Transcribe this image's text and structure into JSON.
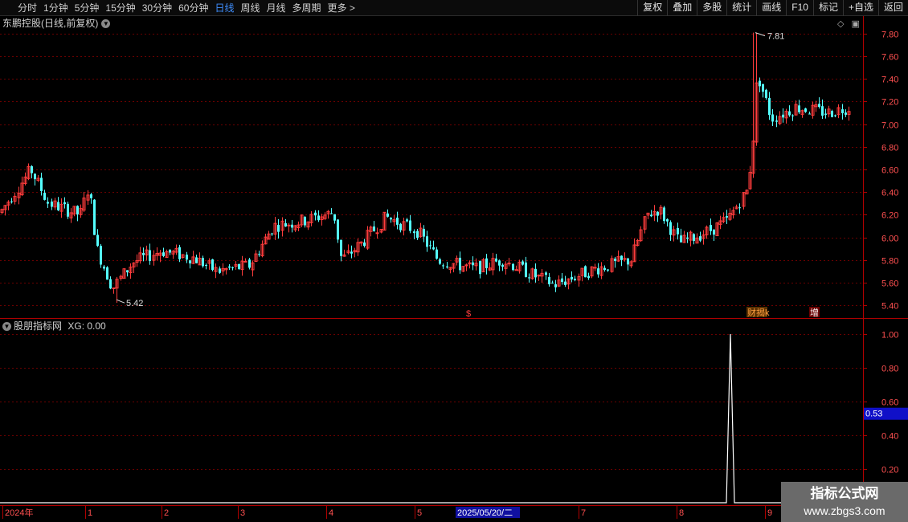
{
  "toolbar": {
    "periods": [
      "分时",
      "1分钟",
      "5分钟",
      "15分钟",
      "30分钟",
      "60分钟",
      "日线",
      "周线",
      "月线",
      "多周期",
      "更多 >"
    ],
    "active_period": "日线",
    "right_buttons": [
      "复权",
      "叠加",
      "多股",
      "统计",
      "画线",
      "F10",
      "标记",
      "+自选",
      "返回"
    ]
  },
  "main_panel": {
    "title": "东鹏控股(日线,前复权)",
    "price_labels": [
      "7.80",
      "7.60",
      "7.40",
      "7.20",
      "7.00",
      "6.80",
      "6.60",
      "6.40",
      "6.20",
      "6.00",
      "5.80",
      "5.60",
      "5.40"
    ],
    "high_marker": "7.81",
    "low_marker": "5.42",
    "event_marks": [
      "$",
      "财",
      "揭k",
      "增"
    ]
  },
  "sub_panel": {
    "title": "股朋指标网",
    "indicator_label": "XG: 0.00",
    "axis_labels": [
      "1.00",
      "0.80",
      "0.60",
      "0.40",
      "0.20"
    ],
    "current_value": "0.53"
  },
  "date_axis": {
    "labels": [
      "2024年",
      "1",
      "2",
      "3",
      "4",
      "5",
      "7",
      "8",
      "9"
    ],
    "cursor_date": "2025/05/20/二"
  },
  "watermark": {
    "title": "指标公式网",
    "url": "www.zbgs3.com"
  },
  "chart_data": {
    "type": "candlestick",
    "title": "东鹏控股(日线,前复权)",
    "price_axis": {
      "ylim": [
        5.4,
        7.9
      ],
      "ticks": [
        7.8,
        7.6,
        7.4,
        7.2,
        7.0,
        6.8,
        6.6,
        6.4,
        6.2,
        6.0,
        5.8,
        5.6,
        5.4
      ]
    },
    "trend_anchors": [
      {
        "x": 0,
        "close": 6.22
      },
      {
        "x": 38,
        "close": 6.6
      },
      {
        "x": 60,
        "close": 6.3
      },
      {
        "x": 100,
        "close": 6.2
      },
      {
        "x": 110,
        "close": 6.45
      },
      {
        "x": 120,
        "close": 5.9
      },
      {
        "x": 140,
        "close": 5.55
      },
      {
        "x": 165,
        "close": 5.78
      },
      {
        "x": 200,
        "close": 5.88
      },
      {
        "x": 240,
        "close": 5.82
      },
      {
        "x": 270,
        "close": 5.7
      },
      {
        "x": 310,
        "close": 5.75
      },
      {
        "x": 340,
        "close": 6.1
      },
      {
        "x": 380,
        "close": 6.15
      },
      {
        "x": 415,
        "close": 6.22
      },
      {
        "x": 425,
        "close": 5.8
      },
      {
        "x": 450,
        "close": 5.95
      },
      {
        "x": 480,
        "close": 6.18
      },
      {
        "x": 520,
        "close": 6.05
      },
      {
        "x": 545,
        "close": 5.8
      },
      {
        "x": 590,
        "close": 5.72
      },
      {
        "x": 625,
        "close": 5.8
      },
      {
        "x": 665,
        "close": 5.66
      },
      {
        "x": 690,
        "close": 5.58
      },
      {
        "x": 740,
        "close": 5.72
      },
      {
        "x": 785,
        "close": 5.8
      },
      {
        "x": 805,
        "close": 6.2
      },
      {
        "x": 820,
        "close": 6.25
      },
      {
        "x": 845,
        "close": 5.95
      },
      {
        "x": 880,
        "close": 6.05
      },
      {
        "x": 905,
        "close": 6.15
      },
      {
        "x": 930,
        "close": 6.42
      },
      {
        "x": 937,
        "close": 6.9
      },
      {
        "x": 942,
        "close": 7.45
      },
      {
        "x": 960,
        "close": 7.05
      },
      {
        "x": 990,
        "close": 7.15
      },
      {
        "x": 1030,
        "close": 7.1
      },
      {
        "x": 1055,
        "close": 7.15
      }
    ],
    "high": 7.81,
    "low": 5.42,
    "indicator": {
      "name": "XG",
      "value": 0.0,
      "ylim": [
        0,
        1.05
      ],
      "spike": {
        "value": 1.0
      }
    }
  }
}
